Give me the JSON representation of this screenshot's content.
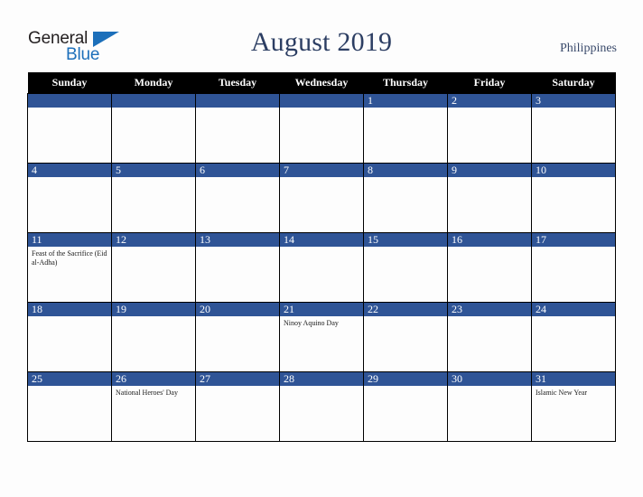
{
  "brand": {
    "name_part1": "General",
    "name_part2": "Blue",
    "triangle_color": "#1c6fba",
    "text_color": "#231f20"
  },
  "header": {
    "title": "August 2019",
    "country": "Philippines",
    "title_color": "#2c3e63"
  },
  "calendar": {
    "weekday_headers": [
      "Sunday",
      "Monday",
      "Tuesday",
      "Wednesday",
      "Thursday",
      "Friday",
      "Saturday"
    ],
    "header_bg": "#000000",
    "daynum_bg": "#2f5496",
    "weeks": [
      [
        {
          "day": "",
          "events": []
        },
        {
          "day": "",
          "events": []
        },
        {
          "day": "",
          "events": []
        },
        {
          "day": "",
          "events": []
        },
        {
          "day": "1",
          "events": []
        },
        {
          "day": "2",
          "events": []
        },
        {
          "day": "3",
          "events": []
        }
      ],
      [
        {
          "day": "4",
          "events": []
        },
        {
          "day": "5",
          "events": []
        },
        {
          "day": "6",
          "events": []
        },
        {
          "day": "7",
          "events": []
        },
        {
          "day": "8",
          "events": []
        },
        {
          "day": "9",
          "events": []
        },
        {
          "day": "10",
          "events": []
        }
      ],
      [
        {
          "day": "11",
          "events": [
            "Feast of the Sacrifice (Eid al-Adha)"
          ]
        },
        {
          "day": "12",
          "events": []
        },
        {
          "day": "13",
          "events": []
        },
        {
          "day": "14",
          "events": []
        },
        {
          "day": "15",
          "events": []
        },
        {
          "day": "16",
          "events": []
        },
        {
          "day": "17",
          "events": []
        }
      ],
      [
        {
          "day": "18",
          "events": []
        },
        {
          "day": "19",
          "events": []
        },
        {
          "day": "20",
          "events": []
        },
        {
          "day": "21",
          "events": [
            "Ninoy Aquino Day"
          ]
        },
        {
          "day": "22",
          "events": []
        },
        {
          "day": "23",
          "events": []
        },
        {
          "day": "24",
          "events": []
        }
      ],
      [
        {
          "day": "25",
          "events": []
        },
        {
          "day": "26",
          "events": [
            "National Heroes' Day"
          ]
        },
        {
          "day": "27",
          "events": []
        },
        {
          "day": "28",
          "events": []
        },
        {
          "day": "29",
          "events": []
        },
        {
          "day": "30",
          "events": []
        },
        {
          "day": "31",
          "events": [
            "Islamic New Year"
          ]
        }
      ]
    ]
  }
}
